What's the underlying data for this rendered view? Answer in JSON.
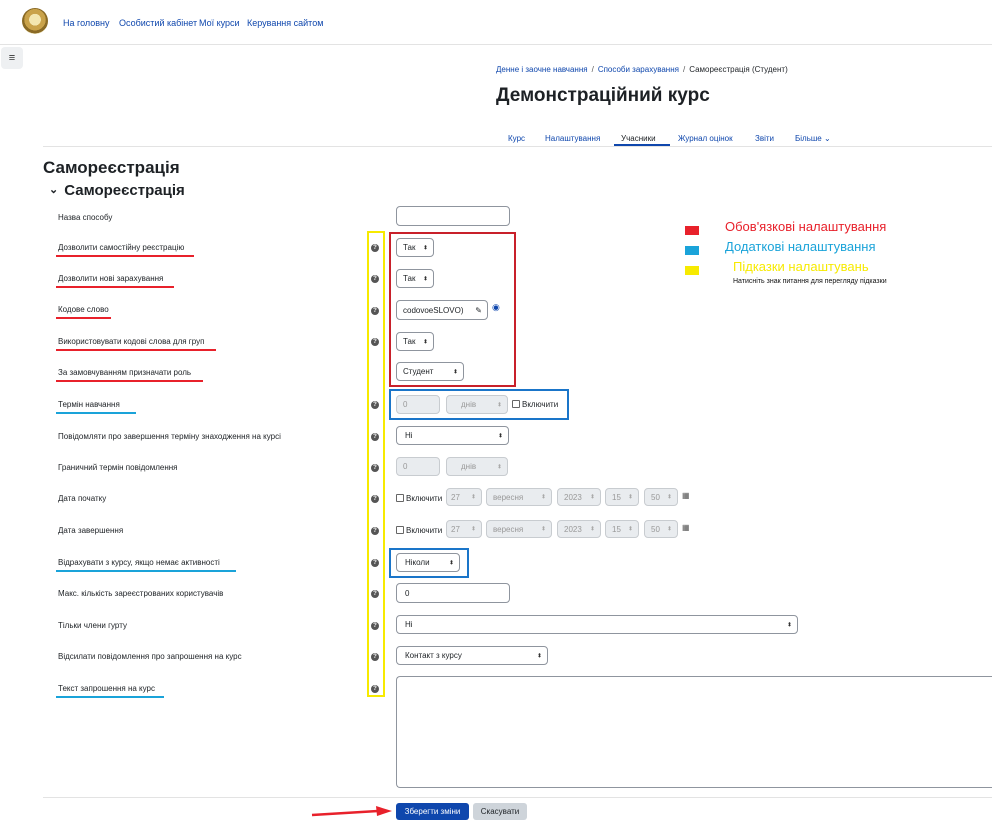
{
  "nav": [
    "На головну",
    "Особистий кабінет",
    "Мої курси",
    "Керування сайтом"
  ],
  "breadcrumb": [
    "Денне і заочне навчання",
    "Способи зарахування",
    "Самореєстрація (Студент)"
  ],
  "breadcrumb_sep": "/",
  "course_title": "Демонстраційний курс",
  "tabs": [
    "Курс",
    "Налаштування",
    "Учасники",
    "Журнал оцінок",
    "Звіти",
    "Більше ⌄"
  ],
  "page_heading": "Самореєстрація",
  "section_heading": "Самореєстрація",
  "labels": {
    "method_name": "Назва способу",
    "allow_self": "Дозволити самостійну реєстрацію",
    "allow_new": "Дозволити нові зарахування",
    "key": "Кодове слово",
    "group_key": "Використовувати кодові слова для груп",
    "default_role": "За замовчуванням призначати роль",
    "duration": "Термін навчання",
    "notify_expiry": "Повідомляти про завершення терміну знаходження на курсі",
    "threshold": "Граничний термін повідомлення",
    "start_date": "Дата початку",
    "end_date": "Дата завершення",
    "unenrol_inactive": "Відрахувати з курсу, якщо немає активності",
    "max_enrolled": "Макс. кількість зареєстрованих користувачів",
    "cohort_only": "Тільки члени гурту",
    "send_welcome": "Відсилати повідомлення про запрошення на курс",
    "welcome_text": "Текст запрошення на курс"
  },
  "values": {
    "method_name": "",
    "allow_self": "Так",
    "allow_new": "Так",
    "key": "codovoeSLOVO)",
    "group_key": "Так",
    "default_role": "Студент",
    "duration_num": "0",
    "duration_unit": "днів",
    "duration_enable": "Включити",
    "notify_expiry": "Ні",
    "threshold_num": "0",
    "threshold_unit": "днів",
    "date_enable": "Включити",
    "start_day": "27",
    "start_month": "вересня",
    "start_year": "2023",
    "start_hour": "15",
    "start_min": "50",
    "end_day": "27",
    "end_month": "вересня",
    "end_year": "2023",
    "end_hour": "15",
    "end_min": "50",
    "unenrol_inactive": "Ніколи",
    "max_enrolled": "0",
    "cohort_only": "Ні",
    "send_welcome": "Контакт з курсу",
    "welcome_text": ""
  },
  "help_glyph": "?",
  "caret_glyph": "⬍",
  "legend": {
    "required": "Обов'язкові налаштування",
    "optional": "Додаткові налаштування",
    "hints": "Підказки налаштувань",
    "hints_note": "Натисніть знак питання для перегляду підказки"
  },
  "colors": {
    "required": "#e8212b",
    "optional": "#1aa3d9",
    "hints": "#f7ea00",
    "link": "#0f47ad",
    "primary_button": "#0f47ad"
  },
  "buttons": {
    "save": "Зберегти зміни",
    "cancel": "Скасувати"
  },
  "icons": [
    "site-logo-icon",
    "drawer-menu-icon",
    "chevron-down-icon",
    "help-icon",
    "pencil-icon",
    "eye-icon",
    "calendar-icon",
    "arrow-icon"
  ]
}
